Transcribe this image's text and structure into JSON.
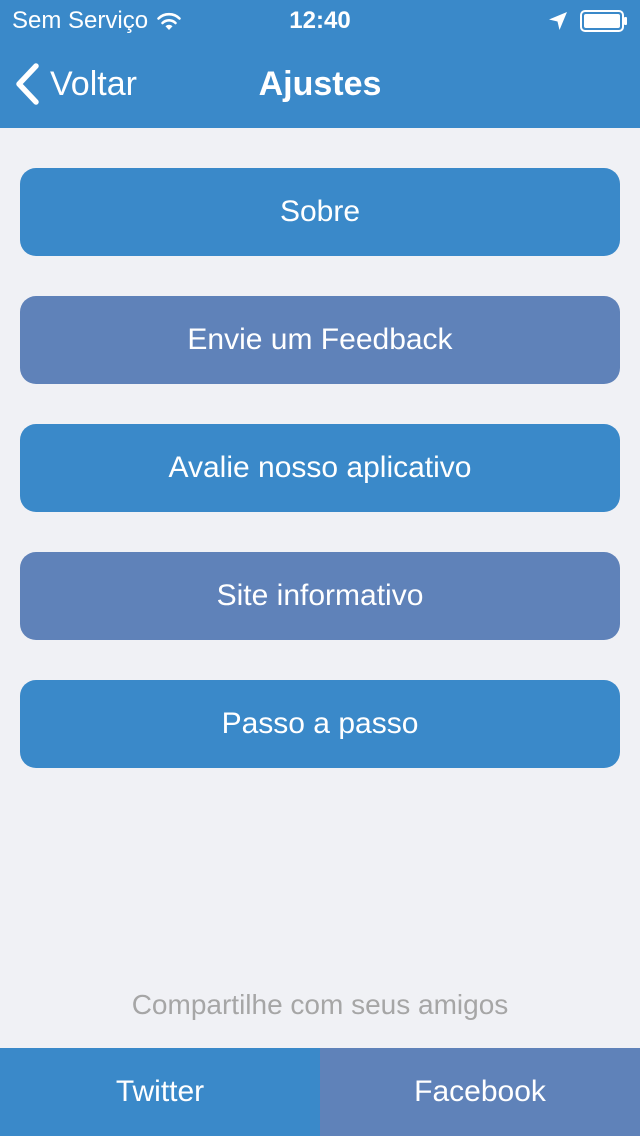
{
  "status_bar": {
    "carrier": "Sem Serviço",
    "time": "12:40",
    "icons": [
      "wifi-icon",
      "location-arrow-icon",
      "battery-icon"
    ]
  },
  "nav": {
    "back_label": "Voltar",
    "title": "Ajustes",
    "back_icon": "chevron-left-icon"
  },
  "menu": {
    "items": [
      {
        "label": "Sobre"
      },
      {
        "label": "Envie um Feedback"
      },
      {
        "label": "Avalie nosso aplicativo"
      },
      {
        "label": "Site informativo"
      },
      {
        "label": "Passo a passo"
      }
    ]
  },
  "share": {
    "caption": "Compartilhe com seus amigos",
    "twitter_label": "Twitter",
    "facebook_label": "Facebook"
  },
  "colors": {
    "primary": "#3a89c9",
    "secondary": "#5f82b9",
    "background": "#f0f1f5",
    "caption": "#a6a6a6"
  }
}
